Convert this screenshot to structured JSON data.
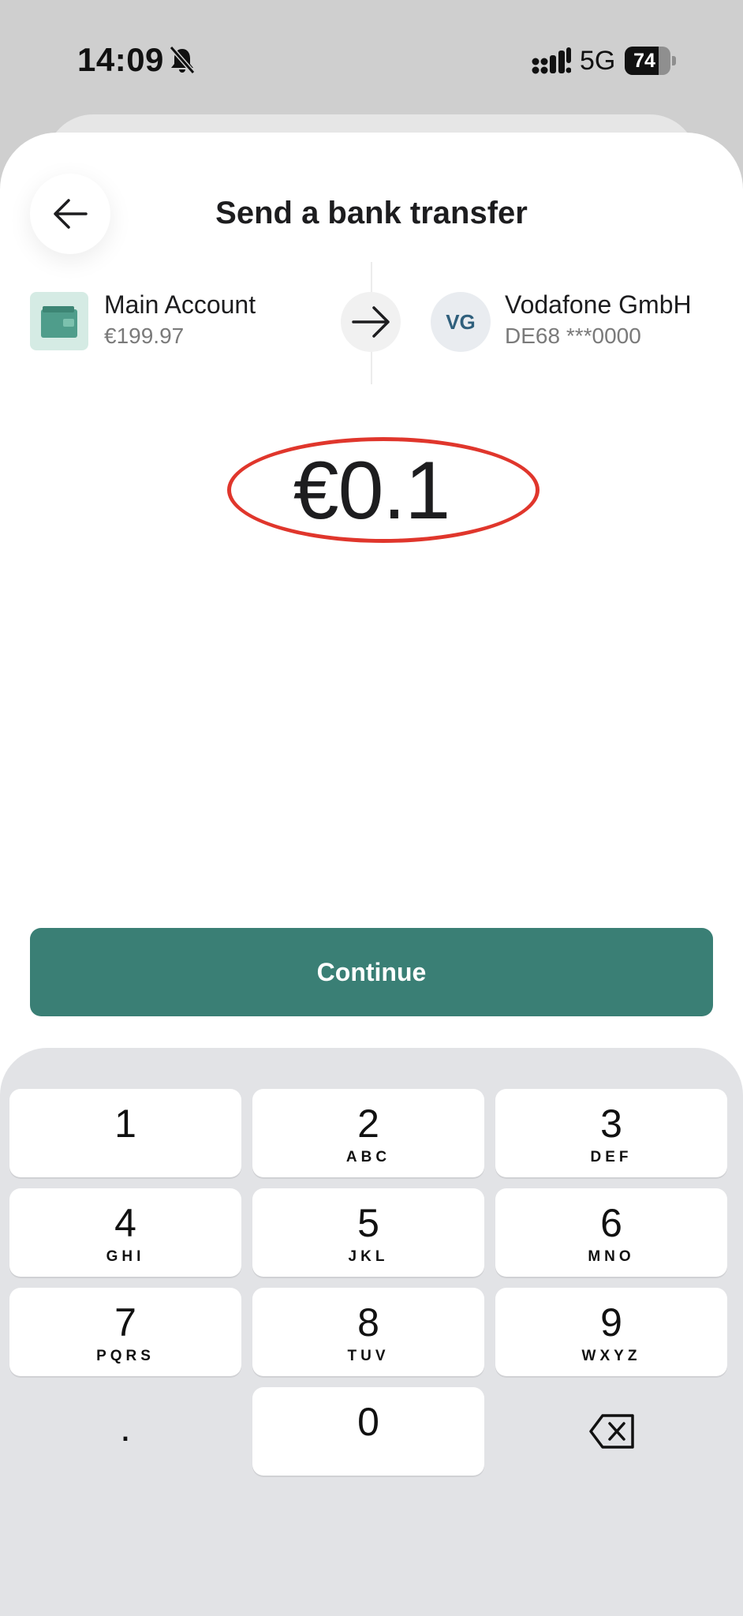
{
  "status_bar": {
    "time": "14:09",
    "network": "5G",
    "battery_percent": "74",
    "battery_level": 0.74,
    "icons": [
      "bell-slash-icon",
      "signal-icon",
      "battery-icon"
    ]
  },
  "header": {
    "title": "Send a bank transfer",
    "back_icon": "arrow-left-icon"
  },
  "transfer": {
    "from": {
      "name": "Main Account",
      "balance": "€199.97",
      "icon": "wallet-icon"
    },
    "to": {
      "initials": "VG",
      "name": "Vodafone GmbH",
      "iban": "DE68 ***0000"
    },
    "direction_icon": "arrow-right-icon"
  },
  "amount": {
    "value": "€0.1"
  },
  "actions": {
    "continue_label": "Continue"
  },
  "colors": {
    "accent": "#3a7f75",
    "highlight": "#e0362c",
    "keypad_bg": "#e2e3e6",
    "avatar_text": "#2f5f7c"
  },
  "keypad": {
    "keys": [
      {
        "digit": "1",
        "letters": ""
      },
      {
        "digit": "2",
        "letters": "ABC"
      },
      {
        "digit": "3",
        "letters": "DEF"
      },
      {
        "digit": "4",
        "letters": "GHI"
      },
      {
        "digit": "5",
        "letters": "JKL"
      },
      {
        "digit": "6",
        "letters": "MNO"
      },
      {
        "digit": "7",
        "letters": "PQRS"
      },
      {
        "digit": "8",
        "letters": "TUV"
      },
      {
        "digit": "9",
        "letters": "WXYZ"
      },
      {
        "digit": ".",
        "letters": ""
      },
      {
        "digit": "0",
        "letters": ""
      }
    ],
    "backspace_icon": "backspace-icon"
  }
}
